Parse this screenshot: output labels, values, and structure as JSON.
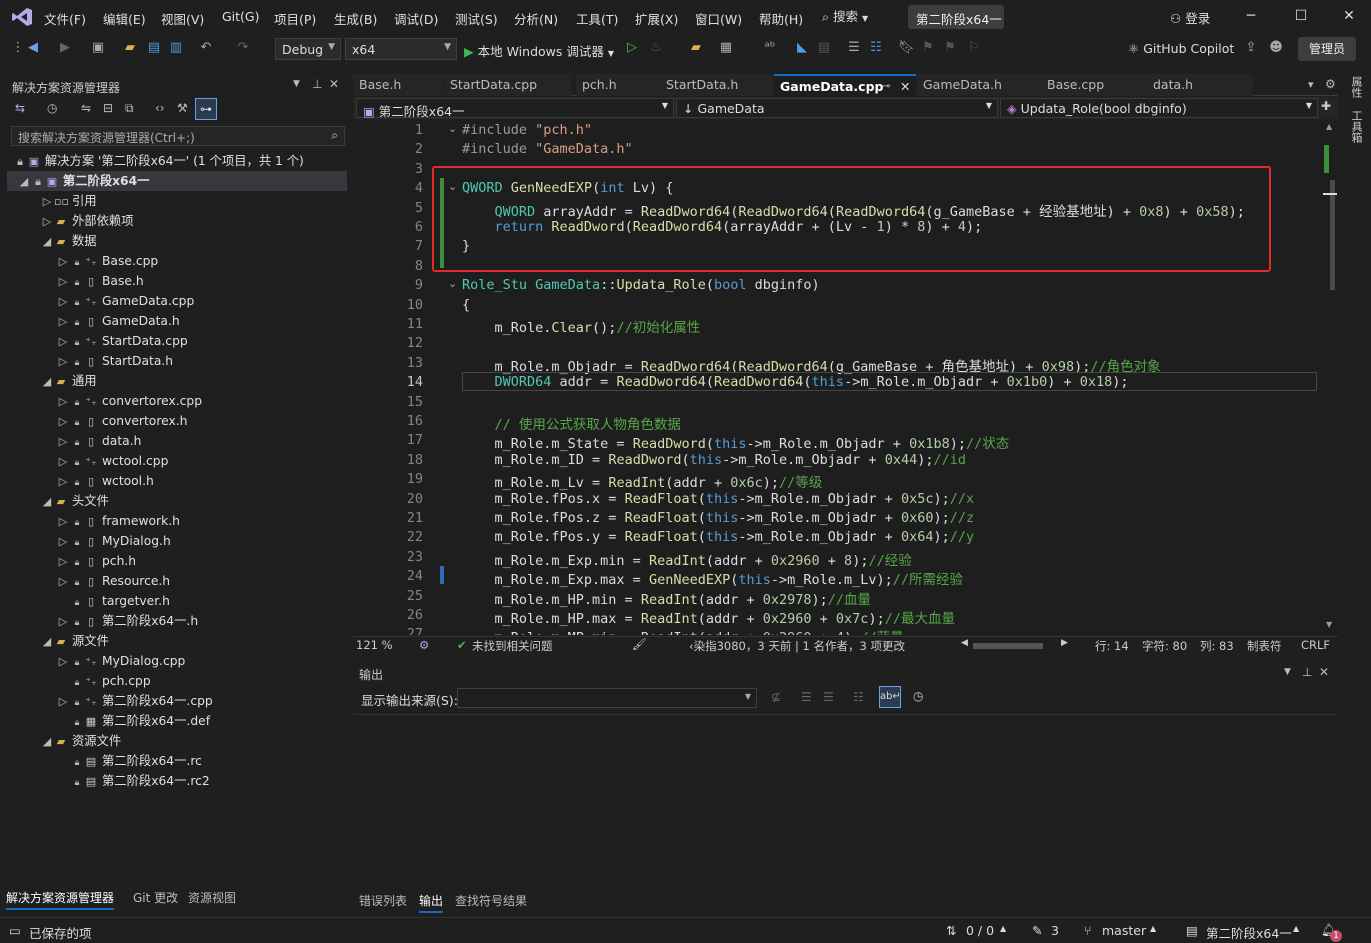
{
  "menubar": {
    "items": [
      "文件(F)",
      "编辑(E)",
      "视图(V)",
      "Git(G)",
      "项目(P)",
      "生成(B)",
      "调试(D)",
      "测试(S)",
      "分析(N)",
      "工具(T)",
      "扩展(X)",
      "窗口(W)",
      "帮助(H)"
    ],
    "search_label": "搜索",
    "project_title": "第二阶段x64一",
    "login": "登录"
  },
  "toolbar": {
    "config": "Debug",
    "platform": "x64",
    "run_label": "本地 Windows 调试器",
    "copilot": "GitHub Copilot",
    "admin": "管理员"
  },
  "solution_explorer": {
    "title": "解决方案资源管理器",
    "search_placeholder": "搜索解决方案资源管理器(Ctrl+;)",
    "solution_label": "解决方案 '第二阶段x64一' (1 个项目，共 1 个)",
    "project_label": "第二阶段x64一",
    "items": [
      {
        "label": "引用",
        "icon": "reference-icon"
      },
      {
        "label": "外部依赖项",
        "icon": "folder-icon"
      },
      {
        "label": "数据",
        "icon": "folder-icon"
      },
      {
        "label": "Base.cpp",
        "icon": "cpp-file-icon"
      },
      {
        "label": "Base.h",
        "icon": "header-file-icon"
      },
      {
        "label": "GameData.cpp",
        "icon": "cpp-file-icon"
      },
      {
        "label": "GameData.h",
        "icon": "header-file-icon"
      },
      {
        "label": "StartData.cpp",
        "icon": "cpp-file-icon"
      },
      {
        "label": "StartData.h",
        "icon": "header-file-icon"
      },
      {
        "label": "通用",
        "icon": "folder-icon"
      },
      {
        "label": "convertorex.cpp",
        "icon": "cpp-file-icon"
      },
      {
        "label": "convertorex.h",
        "icon": "header-file-icon"
      },
      {
        "label": "data.h",
        "icon": "header-file-icon"
      },
      {
        "label": "wctool.cpp",
        "icon": "cpp-file-icon"
      },
      {
        "label": "wctool.h",
        "icon": "header-file-icon"
      },
      {
        "label": "头文件",
        "icon": "folder-icon"
      },
      {
        "label": "framework.h",
        "icon": "header-file-icon"
      },
      {
        "label": "MyDialog.h",
        "icon": "header-file-icon"
      },
      {
        "label": "pch.h",
        "icon": "header-file-icon"
      },
      {
        "label": "Resource.h",
        "icon": "header-file-icon"
      },
      {
        "label": "targetver.h",
        "icon": "header-file-icon"
      },
      {
        "label": "第二阶段x64一.h",
        "icon": "header-file-icon"
      },
      {
        "label": "源文件",
        "icon": "folder-icon"
      },
      {
        "label": "MyDialog.cpp",
        "icon": "cpp-file-icon"
      },
      {
        "label": "pch.cpp",
        "icon": "cpp-file-icon"
      },
      {
        "label": "第二阶段x64一.cpp",
        "icon": "cpp-file-icon"
      },
      {
        "label": "第二阶段x64一.def",
        "icon": "def-file-icon"
      },
      {
        "label": "资源文件",
        "icon": "folder-icon"
      },
      {
        "label": "第二阶段x64一.rc",
        "icon": "rc-file-icon"
      },
      {
        "label": "第二阶段x64一.rc2",
        "icon": "rc-file-icon"
      }
    ],
    "tabs": [
      "解决方案资源管理器",
      "Git 更改",
      "资源视图"
    ]
  },
  "right_strip": [
    "属性",
    "工具箱"
  ],
  "editor": {
    "tabs": [
      "Base.h",
      "StartData.cpp",
      "pch.h",
      "StartData.h",
      "GameData.cpp",
      "GameData.h",
      "Base.cpp",
      "data.h"
    ],
    "nav": {
      "project": "第二阶段x64一",
      "class": "GameData",
      "member": "Updata_Role(bool dbginfo)"
    },
    "line_numbers": [
      "1",
      "2",
      "3",
      "4",
      "5",
      "6",
      "7",
      "8",
      "9",
      "10",
      "11",
      "12",
      "13",
      "14",
      "15",
      "16",
      "17",
      "18",
      "19",
      "20",
      "21",
      "22",
      "23",
      "24",
      "25",
      "26",
      "27"
    ],
    "status": {
      "zoom": "121 %",
      "issues": "未找到相关问题",
      "blame": "染指3080，3 天前 | 1 名作者，3 项更改",
      "line": "行: 14",
      "char": "字符: 80",
      "col": "列: 83",
      "tabs": "制表符",
      "eol": "CRLF"
    }
  },
  "output": {
    "title": "输出",
    "source_label": "显示输出来源(S):",
    "tabs": [
      "错误列表",
      "输出",
      "查找符号结果"
    ]
  },
  "statusbar": {
    "saved": "已保存的项",
    "sync": "0 / 0",
    "edits": "3",
    "branch": "master",
    "repo": "第二阶段x64一",
    "notifications": "1"
  }
}
